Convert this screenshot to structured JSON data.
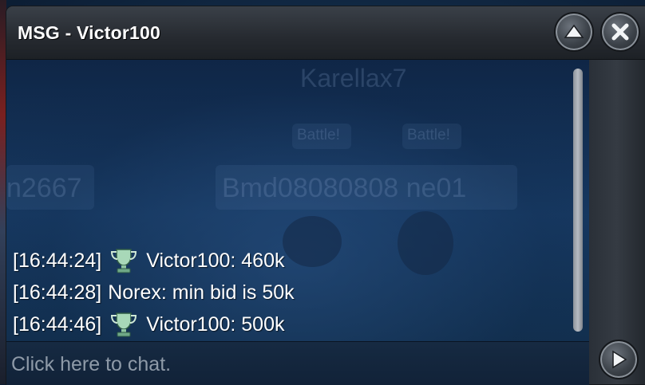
{
  "window": {
    "title": "MSG - Victor100"
  },
  "background": {
    "ghost_texts": [
      "Karellax7",
      "Battle!",
      "Battle!",
      "n2667",
      "Bmd08080808 ne01"
    ]
  },
  "messages": [
    {
      "time": "[16:44:24]",
      "has_trophy": true,
      "text": "Victor100: 460k"
    },
    {
      "time": "[16:44:28]",
      "has_trophy": false,
      "text": "Norex: min bid is 50k"
    },
    {
      "time": "[16:44:46]",
      "has_trophy": true,
      "text": "Victor100: 500k"
    }
  ],
  "input": {
    "placeholder": "Click here to chat."
  },
  "icons": {
    "minimize": "chevron-up-icon",
    "close": "close-icon",
    "send": "play-arrow-icon",
    "trophy": "trophy-icon"
  },
  "colors": {
    "chat_bg": "#173a63",
    "titlebar": "#2a2f36",
    "text": "#ffffff",
    "placeholder": "#8e9aa8"
  }
}
